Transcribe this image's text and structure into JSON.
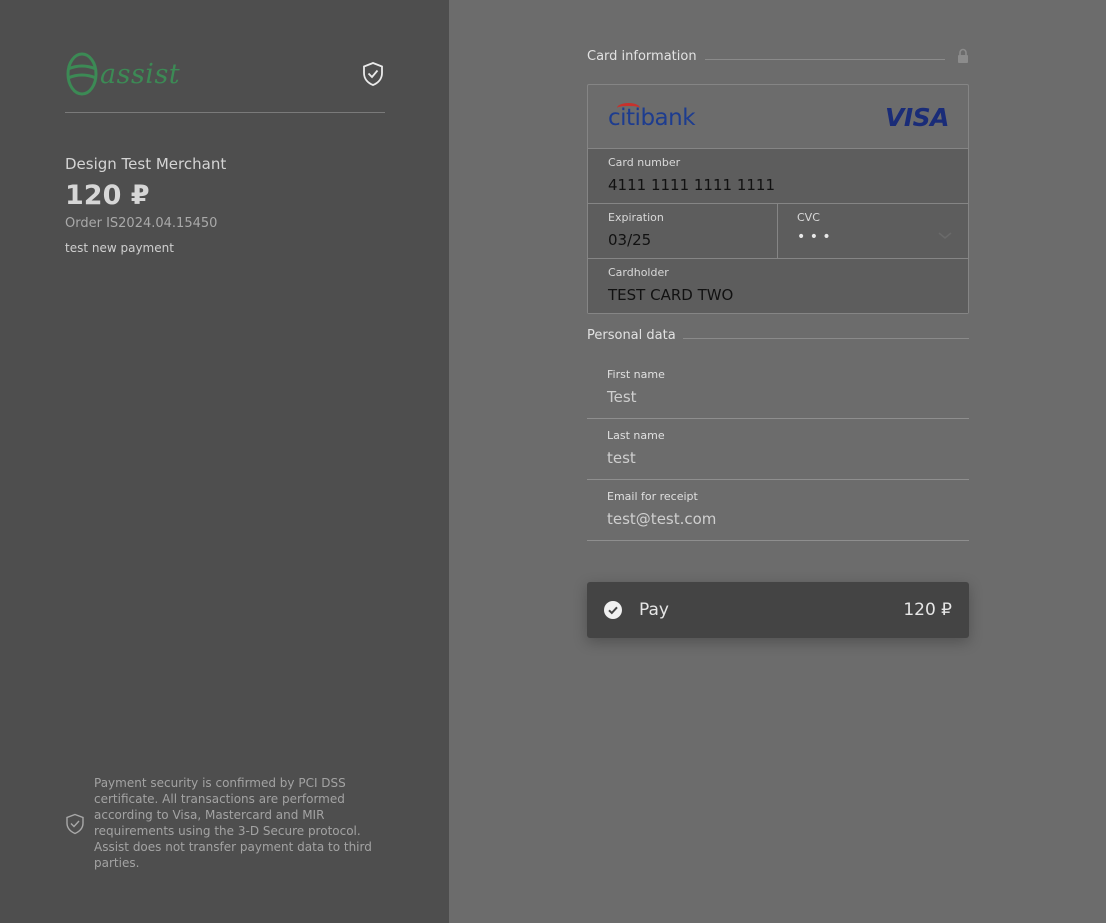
{
  "brand": {
    "logo_text": "assist",
    "logo_color": "#3c8a55"
  },
  "merchant": {
    "name": "Design Test Merchant",
    "amount": "120 ₽",
    "order": "Order  IS2024.04.15450",
    "description": "test new payment"
  },
  "security_note": "Payment security is confirmed by PCI DSS certificate. All transactions are performed according to Visa, Mastercard and MIR requirements using the 3-D Secure protocol. Assist does not transfer payment data to third parties.",
  "card_section": {
    "title": "Card information",
    "bank": "citibank",
    "network": "VISA",
    "card_number_label": "Card number",
    "card_number": "4111  1111  1111  1111",
    "expiration_label": "Expiration",
    "expiration": "03/25",
    "cvc_label": "CVC",
    "cvc": "• • •",
    "cardholder_label": "Cardholder",
    "cardholder": "TEST CARD TWO"
  },
  "personal_section": {
    "title": "Personal data",
    "first_name_label": "First name",
    "first_name": "Test",
    "last_name_label": "Last name",
    "last_name": "test",
    "email_label": "Email for receipt",
    "email": "test@test.com"
  },
  "pay_button": {
    "label": "Pay",
    "amount": "120 ₽"
  }
}
